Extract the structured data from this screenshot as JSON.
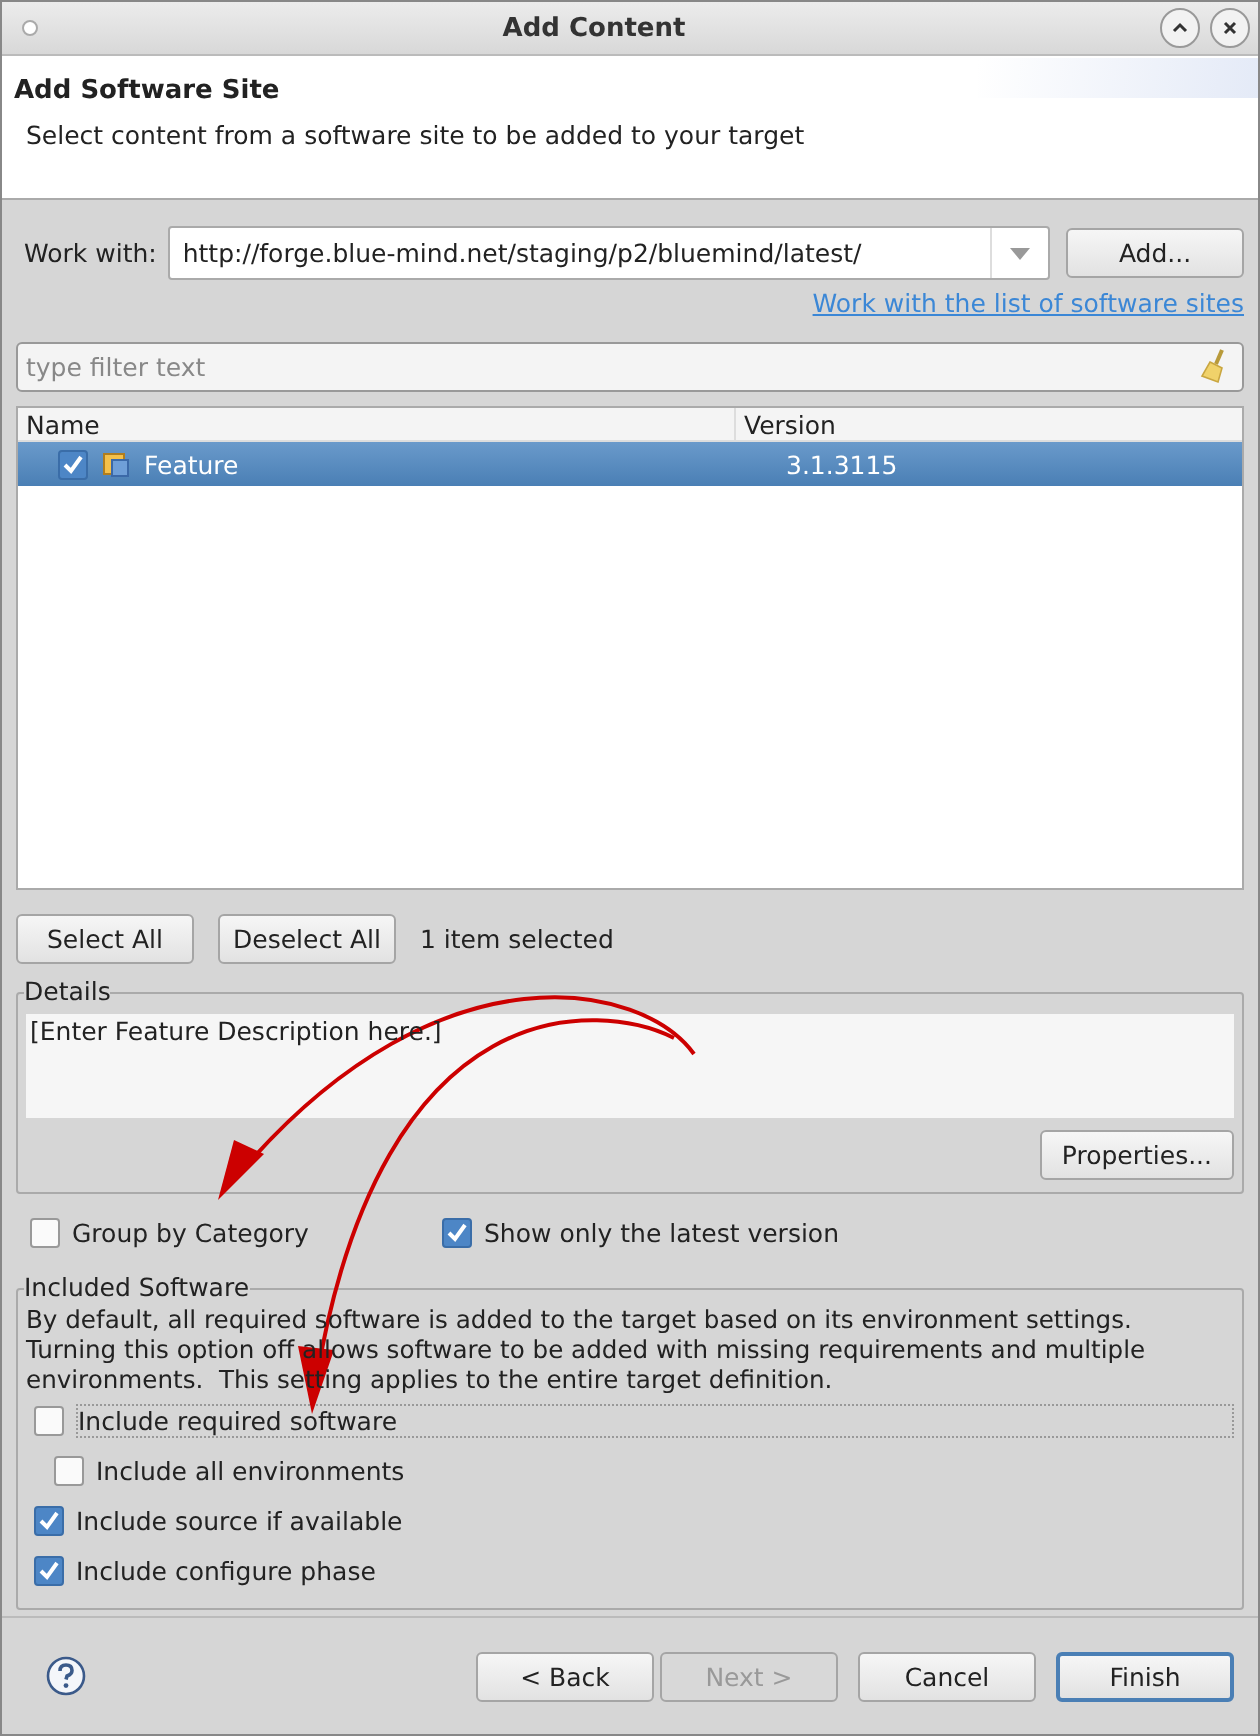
{
  "window": {
    "title": "Add Content"
  },
  "header": {
    "title": "Add Software Site",
    "description": "Select content from a software site to be added to your target"
  },
  "work_with": {
    "label": "Work with:",
    "value": "http://forge.blue-mind.net/staging/p2/bluemind/latest/",
    "add_button": "Add...",
    "link": "Work with the list of software sites"
  },
  "filter": {
    "placeholder": "type filter text"
  },
  "table": {
    "columns": [
      "Name",
      "Version"
    ],
    "rows": [
      {
        "name": "Feature",
        "version": "3.1.3115",
        "checked": true,
        "selected": true
      }
    ]
  },
  "selection": {
    "buttons": [
      "Select All",
      "Deselect All"
    ],
    "status": "1 item selected"
  },
  "details": {
    "label": "Details",
    "text": "[Enter Feature Description here.]",
    "button": "Properties..."
  },
  "options": [
    {
      "label": "Group by Category",
      "checked": false
    },
    {
      "label": "Show only the latest version",
      "checked": true
    }
  ],
  "included_software": {
    "label": "Included Software",
    "description": "By default, all required software is added to the target based on its environment settings. Turning this option off allows software to be added with missing requirements and multiple environments.  This setting applies to the entire target definition.",
    "options": [
      {
        "label": "Include required software",
        "checked": false,
        "focused": true,
        "children": [
          {
            "label": "Include all environments",
            "checked": false
          }
        ]
      },
      {
        "label": "Include source if available",
        "checked": true
      },
      {
        "label": "Include configure phase",
        "checked": true
      }
    ]
  },
  "footer": {
    "buttons": [
      {
        "label": "< Back",
        "disabled": false,
        "default": false
      },
      {
        "label": "Next >",
        "disabled": true,
        "default": false
      },
      {
        "label": "Cancel",
        "disabled": false,
        "default": false
      },
      {
        "label": "Finish",
        "disabled": false,
        "default": true
      }
    ]
  }
}
